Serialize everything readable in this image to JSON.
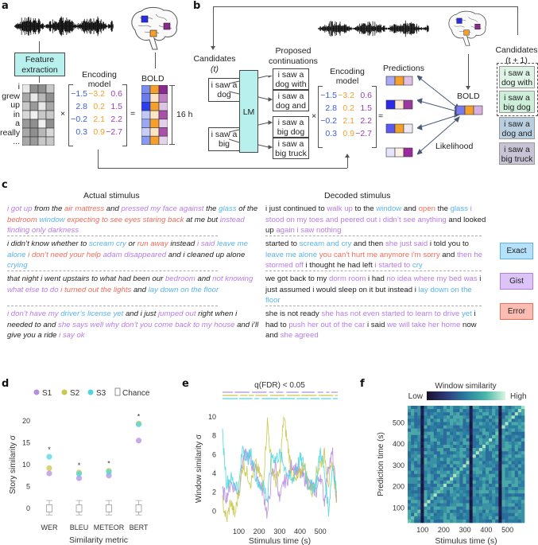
{
  "panels": {
    "a": {
      "label": "a",
      "feature_extraction": [
        "Feature",
        "extraction"
      ],
      "words": [
        "i",
        "grew",
        "up",
        "in",
        "a",
        "really",
        "..."
      ],
      "times_symbol": "×",
      "equals_symbol": "=",
      "encoding_model_title": [
        "Encoding",
        "model"
      ],
      "encoding_matrix": [
        [
          "−1.5",
          "−3.2",
          "0.6"
        ],
        [
          "2.8",
          "0.2",
          "1.5"
        ],
        [
          "−0.2",
          "2.1",
          "2.2"
        ],
        [
          "0.3",
          "0.9",
          "−2.7"
        ]
      ],
      "bold_label": "BOLD",
      "duration_label": "16 h"
    },
    "b": {
      "label": "b",
      "candidates_t": [
        "Candidates",
        "(t)"
      ],
      "candidates": [
        [
          "i saw a",
          "dog"
        ],
        [
          "i saw a",
          "big"
        ]
      ],
      "lm_label": "LM",
      "proposed_title": [
        "Proposed",
        "continuations"
      ],
      "proposed": [
        [
          "i saw a",
          "dog with"
        ],
        [
          "i saw a",
          "dog and"
        ],
        [
          "i saw a",
          "big dog"
        ],
        [
          "i saw a",
          "big truck"
        ]
      ],
      "times_symbol": "×",
      "equals_symbol": "=",
      "encoding_model_title": [
        "Encoding",
        "model"
      ],
      "encoding_matrix": [
        [
          "−1.5",
          "−3.2",
          "0.6"
        ],
        [
          "2.8",
          "0.2",
          "1.5"
        ],
        [
          "−0.2",
          "2.1",
          "2.2"
        ],
        [
          "0.3",
          "0.9",
          "−2.7"
        ]
      ],
      "predictions_label": "Predictions",
      "bold_label": "BOLD",
      "likelihood_label": "Likelihood",
      "candidates_t1": [
        "Candidates",
        "(t + 1)"
      ],
      "next_candidates": [
        {
          "text": [
            "i saw a",
            "dog with"
          ],
          "color": "#dff3e6",
          "kept": true
        },
        {
          "text": [
            "i saw a",
            "big dog"
          ],
          "color": "#cdeed8",
          "kept": true
        },
        {
          "text": [
            "i saw a",
            "dog and"
          ],
          "color": "#b9cfe0",
          "kept": false
        },
        {
          "text": [
            "i saw a",
            "big truck"
          ],
          "color": "#c9c3d6",
          "kept": false
        }
      ]
    },
    "c": {
      "label": "c",
      "actual_title": "Actual stimulus",
      "decoded_title": "Decoded stimulus",
      "legend": [
        {
          "label": "Exact",
          "bg": "#b5e1fa",
          "border": "#5ab4ee"
        },
        {
          "label": "Gist",
          "bg": "#dcc4f8",
          "border": "#b77ce8"
        },
        {
          "label": "Error",
          "bg": "#fbbcb2",
          "border": "#f26b5b"
        }
      ],
      "rows": [
        {
          "actual": [
            [
              "gist",
              "i got up"
            ],
            [
              "plain",
              " from the "
            ],
            [
              "error",
              "air mattress"
            ],
            [
              "plain",
              " and "
            ],
            [
              "gist",
              "pressed my face against"
            ],
            [
              "plain",
              " the "
            ],
            [
              "exact",
              "glass"
            ],
            [
              "plain",
              " of the "
            ],
            [
              "error",
              "bedroom"
            ],
            [
              "plain",
              " "
            ],
            [
              "exact",
              "window"
            ],
            [
              "plain",
              " "
            ],
            [
              "error",
              "expecting to see eyes staring back"
            ],
            [
              "plain",
              " at me but "
            ],
            [
              "gist",
              "instead finding only darkness"
            ]
          ],
          "decoded": [
            [
              "plain",
              "i just continued to "
            ],
            [
              "gist",
              "walk up"
            ],
            [
              "plain",
              " to the "
            ],
            [
              "exact",
              "window"
            ],
            [
              "plain",
              " and "
            ],
            [
              "error",
              "open"
            ],
            [
              "plain",
              " the "
            ],
            [
              "exact",
              "glass"
            ],
            [
              "gist",
              " i stood on my toes and peered out i didn’t see anything"
            ],
            [
              "plain",
              " and looked up "
            ],
            [
              "gist",
              "again i saw nothing"
            ]
          ]
        },
        {
          "actual": [
            [
              "plain",
              "i didn’t know whether to "
            ],
            [
              "exact",
              "scream cry"
            ],
            [
              "plain",
              " or "
            ],
            [
              "error",
              "run away"
            ],
            [
              "plain",
              " instead "
            ],
            [
              "gist",
              "i said"
            ],
            [
              "plain",
              " "
            ],
            [
              "exact",
              "leave me alone"
            ],
            [
              "plain",
              " "
            ],
            [
              "error",
              "i don’t need your help"
            ],
            [
              "plain",
              " "
            ],
            [
              "gist",
              "adam disappeared"
            ],
            [
              "plain",
              " and i cleaned up alone "
            ],
            [
              "exact",
              "crying"
            ]
          ],
          "decoded": [
            [
              "plain",
              "started to "
            ],
            [
              "exact",
              "scream and cry"
            ],
            [
              "plain",
              " and then "
            ],
            [
              "gist",
              "she just said"
            ],
            [
              "plain",
              " i told you to "
            ],
            [
              "exact",
              "leave me alone"
            ],
            [
              "plain",
              " "
            ],
            [
              "error",
              "you can't hurt me anymore i'm sorry"
            ],
            [
              "plain",
              " and "
            ],
            [
              "gist",
              "then he stormed off"
            ],
            [
              "plain",
              " i thought he had left "
            ],
            [
              "gist",
              "i started to "
            ],
            [
              "exact",
              "cry"
            ]
          ]
        },
        {
          "actual": [
            [
              "plain",
              "that night i went upstairs to what had been our "
            ],
            [
              "gist",
              "bedroom"
            ],
            [
              "plain",
              " and "
            ],
            [
              "gist",
              "not knowing what else to do"
            ],
            [
              "plain",
              " "
            ],
            [
              "error",
              "i turned out the lights"
            ],
            [
              "plain",
              " and "
            ],
            [
              "exact",
              "lay down on the floor"
            ]
          ],
          "decoded": [
            [
              "plain",
              "we got back to my "
            ],
            [
              "gist",
              "dorm room"
            ],
            [
              "plain",
              " i had "
            ],
            [
              "gist",
              "no idea where my bed was"
            ],
            [
              "plain",
              " i just assumed i would sleep on it but instead i "
            ],
            [
              "exact",
              "lay down on the floor"
            ]
          ]
        },
        {
          "actual": [
            [
              "gist",
              "i don’t have my "
            ],
            [
              "exact",
              "driver’s license yet"
            ],
            [
              "plain",
              " and i just "
            ],
            [
              "gist",
              "jumped out"
            ],
            [
              "plain",
              " right when i needed to and "
            ],
            [
              "gist",
              "she says well why don’t you come back to my house"
            ],
            [
              "plain",
              " and i’ll give you a ride "
            ],
            [
              "gist",
              "i say ok"
            ]
          ],
          "decoded": [
            [
              "plain",
              "she is not ready "
            ],
            [
              "gist",
              "she has not even started to learn to drive"
            ],
            [
              "plain",
              " "
            ],
            [
              "exact",
              "yet"
            ],
            [
              "plain",
              " i had to "
            ],
            [
              "gist",
              "push her out of the car"
            ],
            [
              "plain",
              " i said "
            ],
            [
              "gist",
              "we will take her home"
            ],
            [
              "plain",
              " now and "
            ],
            [
              "gist",
              "she agreed"
            ]
          ]
        }
      ]
    },
    "d": {
      "label": "d"
    },
    "e": {
      "label": "e"
    },
    "f": {
      "label": "f"
    }
  },
  "colors": {
    "exact": "#5ab4ee",
    "gist": "#b77ce8",
    "error": "#f26b5b",
    "model_col1": "#3a5be8",
    "model_col2": "#f5a02a",
    "model_col3": "#9b3fb0",
    "lm_fill": "#b8f0ee"
  },
  "chart_data": [
    {
      "type": "scatter",
      "panel": "d",
      "xlabel": "Similarity metric",
      "ylabel": "Story similarity σ",
      "categories": [
        "WER",
        "BLEU",
        "METEOR",
        "BERT"
      ],
      "ylim": [
        -2,
        22
      ],
      "yticks": [
        0,
        5,
        10,
        15,
        20
      ],
      "legend": [
        "S1",
        "S2",
        "S3",
        "Chance"
      ],
      "legend_position": "top",
      "series": [
        {
          "name": "S1",
          "color": "#b48ee0",
          "values": [
            8.0,
            6.9,
            7.5,
            15.5
          ]
        },
        {
          "name": "S2",
          "color": "#c9c84a",
          "values": [
            9.2,
            8.2,
            8.6,
            19.4
          ]
        },
        {
          "name": "S3",
          "color": "#4fd6e0",
          "values": [
            11.8,
            7.9,
            8.3,
            19.2
          ]
        }
      ],
      "chance": {
        "median": 0,
        "box": [
          -0.8,
          0.8
        ],
        "whiskers": [
          -1.5,
          1.8
        ]
      },
      "significance": [
        "*",
        "*",
        "*",
        "*"
      ]
    },
    {
      "type": "line",
      "panel": "e",
      "xlabel": "Stimulus time (s)",
      "ylabel": "Window similarity σ",
      "xticks": [
        100,
        200,
        300,
        400,
        500
      ],
      "yticks": [
        0,
        2,
        4,
        6,
        8,
        10
      ],
      "xlim": [
        20,
        585
      ],
      "ylim": [
        -1.5,
        10.5
      ],
      "annotation": "q(FDR) < 0.05",
      "series": [
        {
          "name": "S1",
          "color": "#b48ee0",
          "x": [
            20,
            40,
            60,
            80,
            100,
            120,
            140,
            160,
            180,
            200,
            220,
            240,
            260,
            280,
            300,
            320,
            340,
            360,
            380,
            400,
            420,
            440,
            460,
            480,
            500,
            520,
            540,
            560,
            580
          ],
          "y": [
            2,
            1.5,
            3,
            2.5,
            2,
            5.5,
            6,
            5,
            4.5,
            3,
            2,
            -0.5,
            3.5,
            5,
            1,
            3,
            3.5,
            5,
            4.5,
            4,
            3.5,
            3,
            2.5,
            2,
            4,
            1,
            5,
            6,
            1
          ]
        },
        {
          "name": "S2",
          "color": "#c9c84a",
          "x": [
            20,
            40,
            60,
            80,
            100,
            120,
            140,
            160,
            180,
            200,
            220,
            240,
            260,
            280,
            300,
            320,
            340,
            360,
            380,
            400,
            420,
            440,
            460,
            480,
            500,
            520,
            540,
            560,
            580
          ],
          "y": [
            1,
            -1,
            1,
            -0.5,
            2,
            5,
            4,
            3,
            5,
            4,
            3,
            9.5,
            5,
            3,
            4,
            10,
            7,
            4,
            3,
            4,
            5,
            3,
            2,
            4,
            5,
            6,
            3,
            5,
            1
          ]
        },
        {
          "name": "S3",
          "color": "#4fd6e0",
          "x": [
            20,
            40,
            60,
            80,
            100,
            120,
            140,
            160,
            180,
            200,
            220,
            240,
            260,
            280,
            300,
            320,
            340,
            360,
            380,
            400,
            420,
            440,
            460,
            480,
            500,
            520,
            540,
            560,
            580
          ],
          "y": [
            8,
            3,
            3.5,
            3,
            2.5,
            7,
            5.5,
            6,
            4,
            2.5,
            3,
            1,
            6,
            5.5,
            6,
            5,
            4,
            3,
            4.5,
            5.5,
            5,
            3,
            2.5,
            3,
            6.5,
            4,
            0,
            5,
            2
          ]
        }
      ],
      "significance_bars": [
        "S1",
        "S2",
        "S3"
      ]
    },
    {
      "type": "heatmap",
      "panel": "f",
      "title": "Window similarity",
      "colorbar": {
        "low_label": "Low",
        "high_label": "High",
        "colors": [
          "#1a0f2a",
          "#2d3a7c",
          "#2a7fa0",
          "#49b8a8",
          "#d8f5e0"
        ]
      },
      "xlabel": "Stimulus time (s)",
      "ylabel": "Prediction time (s)",
      "xticks": [
        100,
        200,
        300,
        400,
        500
      ],
      "yticks": [
        100,
        200,
        300,
        400,
        500
      ],
      "xlim": [
        30,
        580
      ],
      "ylim": [
        30,
        580
      ],
      "dark_columns": [
        95,
        325,
        465
      ],
      "diagonal": "bright"
    }
  ]
}
